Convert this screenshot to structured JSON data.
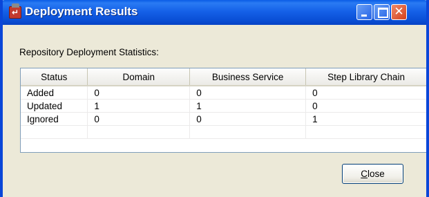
{
  "window": {
    "title": "Deployment Results"
  },
  "section_label": "Repository Deployment Statistics:",
  "table": {
    "columns": [
      "Status",
      "Domain",
      "Business Service",
      "Step Library Chain"
    ],
    "rows": [
      [
        "Added",
        "0",
        "0",
        "0"
      ],
      [
        "Updated",
        "1",
        "1",
        "0"
      ],
      [
        "Ignored",
        "0",
        "0",
        "1"
      ],
      [
        "",
        "",
        "",
        ""
      ]
    ]
  },
  "buttons": {
    "close_mnemonic": "C",
    "close_rest": "lose"
  },
  "colors": {
    "titlebar": "#0a5ce6",
    "close_button_red": "#d2401c",
    "dialog_background": "#ece9d8"
  }
}
